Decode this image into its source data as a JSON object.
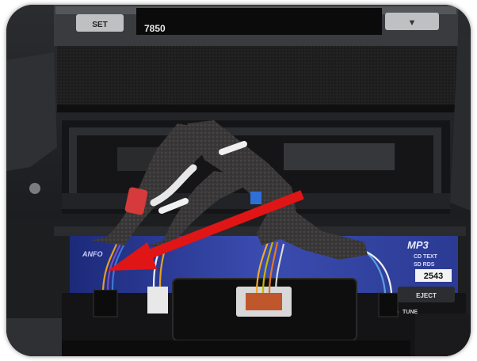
{
  "photo": {
    "subject": "",
    "colors": {
      "arrow": "#e01515",
      "display_blue": "#2d3f9a",
      "tape": "#3a3838",
      "bezel": "#2a2b2e"
    }
  },
  "stereo_top": {
    "set_label": "SET",
    "readout": "7850",
    "down_button_glyph": "▼"
  },
  "radio_face": {
    "brand_text": "MP3",
    "cd_text": "CD TEXT",
    "sub_text": "SD RDS",
    "counter": "2543",
    "eject_label": "EJECT",
    "left_text": "ANFO",
    "tune_label": "TUNE"
  }
}
